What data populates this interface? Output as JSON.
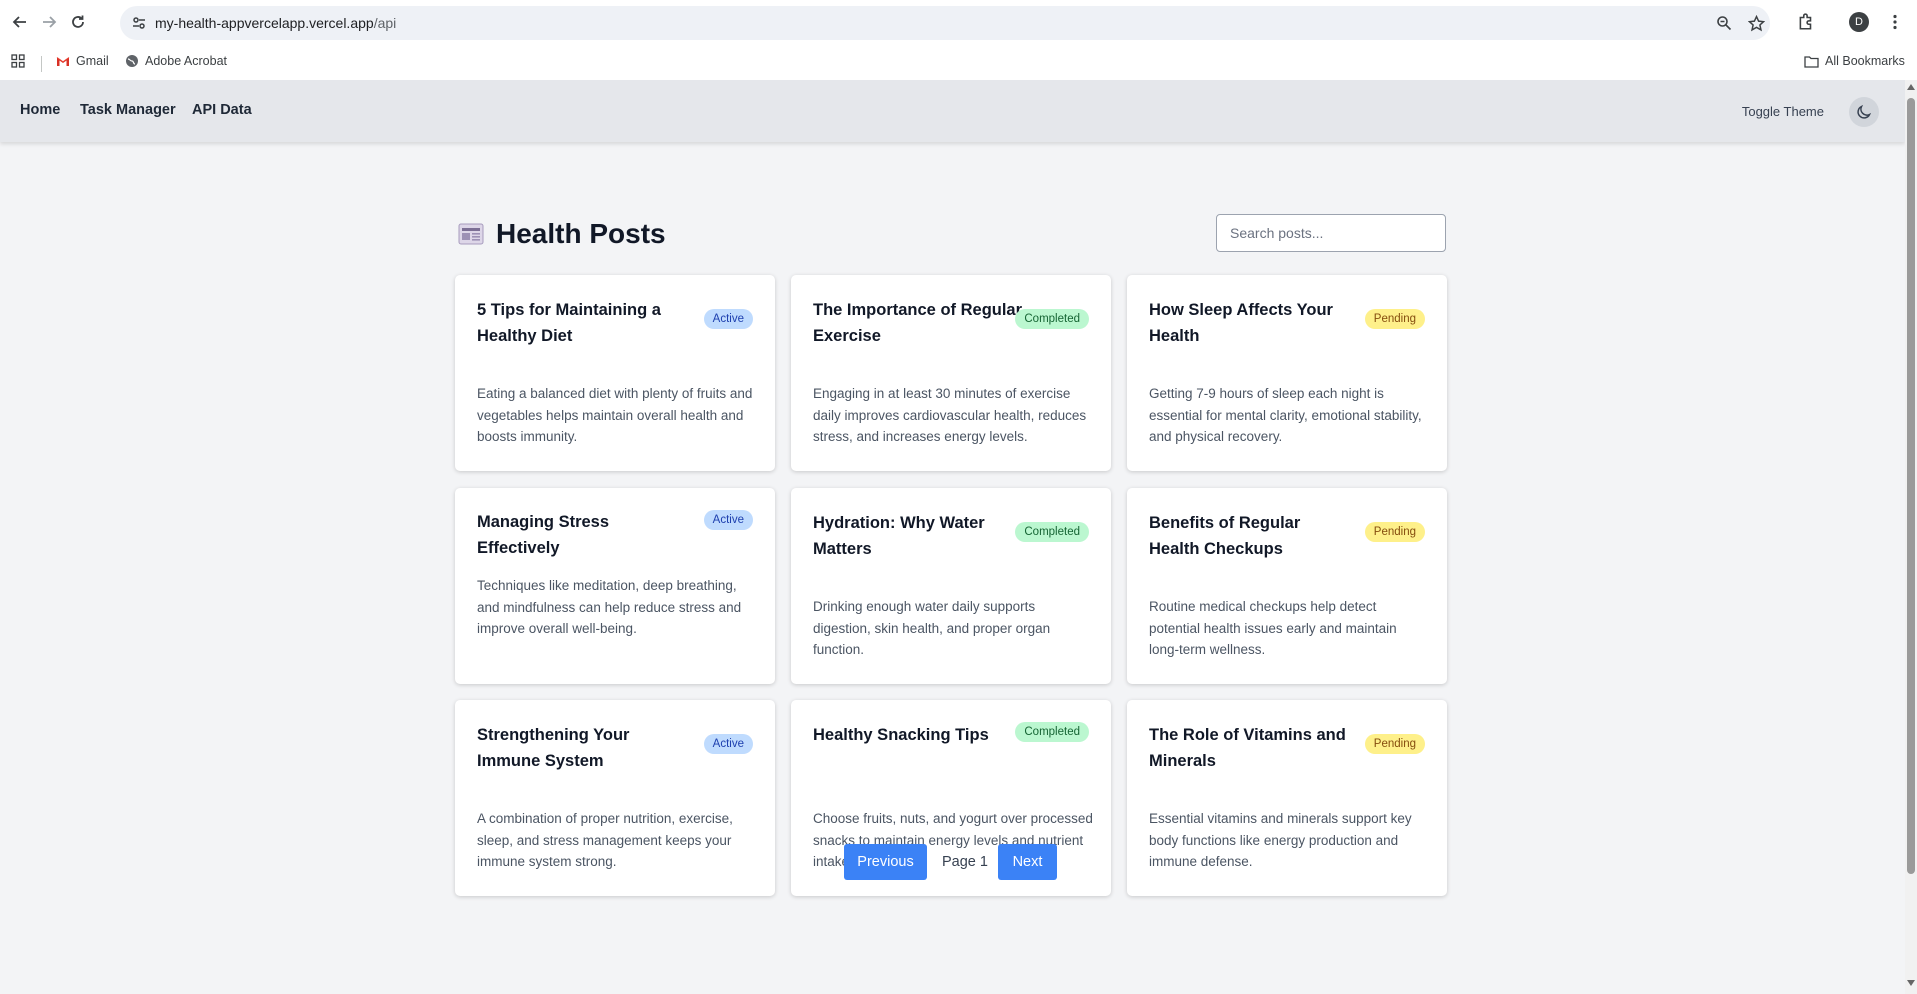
{
  "browser": {
    "url_main": "my-health-appvercelapp.vercel.app",
    "url_path": "/api",
    "profile_initial": "D",
    "bookmarks": [
      {
        "label": "Gmail"
      },
      {
        "label": "Adobe Acrobat"
      }
    ],
    "all_bookmarks_label": "All Bookmarks"
  },
  "app_nav": {
    "links": [
      "Home",
      "Task Manager",
      "API Data"
    ],
    "toggle_theme_label": "Toggle Theme"
  },
  "page": {
    "title": "Health Posts",
    "search_placeholder": "Search posts..."
  },
  "posts": [
    {
      "title": "5 Tips for Maintaining a Healthy Diet",
      "status": "Active",
      "body": "Eating a balanced diet with plenty of fruits and vegetables helps maintain overall health and boosts immunity."
    },
    {
      "title": "The Importance of Regular Exercise",
      "status": "Completed",
      "body": "Engaging in at least 30 minutes of exercise daily improves cardiovascular health, reduces stress, and increases energy levels."
    },
    {
      "title": "How Sleep Affects Your Health",
      "status": "Pending",
      "body": "Getting 7-9 hours of sleep each night is essential for mental clarity, emotional stability, and physical recovery."
    },
    {
      "title": "Managing Stress Effectively",
      "status": "Active",
      "body": "Techniques like meditation, deep breathing, and mindfulness can help reduce stress and improve overall well-being."
    },
    {
      "title": "Hydration: Why Water Matters",
      "status": "Completed",
      "body": "Drinking enough water daily supports digestion, skin health, and proper organ function."
    },
    {
      "title": "Benefits of Regular Health Checkups",
      "status": "Pending",
      "body": "Routine medical checkups help detect potential health issues early and maintain long-term wellness."
    },
    {
      "title": "Strengthening Your Immune System",
      "status": "Active",
      "body": "A combination of proper nutrition, exercise, sleep, and stress management keeps your immune system strong."
    },
    {
      "title": "Healthy Snacking Tips",
      "status": "Completed",
      "body": "Choose fruits, nuts, and yogurt over processed snacks to maintain energy levels and nutrient intake."
    },
    {
      "title": "The Role of Vitamins and Minerals",
      "status": "Pending",
      "body": "Essential vitamins and minerals support key body functions like energy production and immune defense."
    }
  ],
  "pagination": {
    "previous_label": "Previous",
    "page_label": "Page 1",
    "next_label": "Next"
  },
  "colors": {
    "primary_button": "#3b82f6",
    "active_badge_bg": "#bfdbfe",
    "completed_badge_bg": "#bbf7d0",
    "pending_badge_bg": "#fef08a",
    "page_bg": "#f3f4f6",
    "nav_bg": "#e5e7eb"
  }
}
